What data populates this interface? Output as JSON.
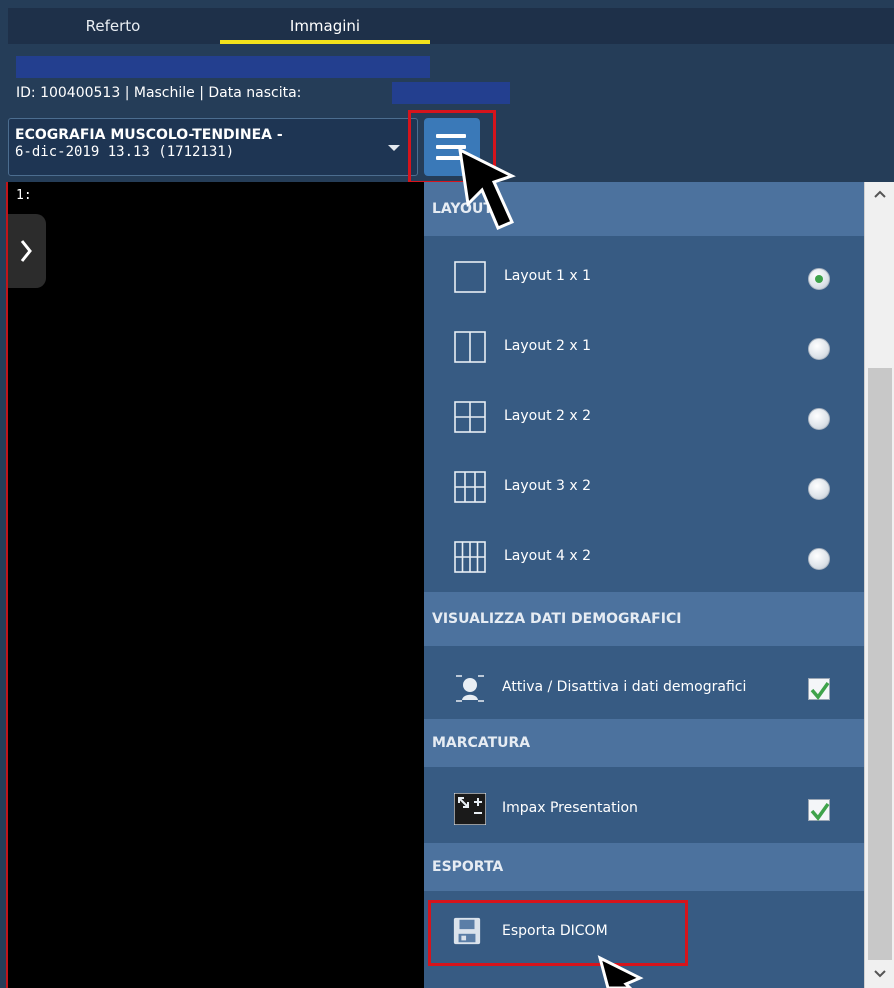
{
  "tabs": [
    {
      "label": "Referto",
      "active": false
    },
    {
      "label": "Immagini",
      "active": true
    }
  ],
  "patient": {
    "info_line": "ID: 100400513 | Maschile | Data nascita:"
  },
  "study_select": {
    "title": "ECOGRAFIA MUSCOLO-TENDINEA -",
    "date": "6-dic-2019 13.13 (1712131)"
  },
  "viewer": {
    "index_label": "1:"
  },
  "menu": {
    "layout_header": "LAYOUT",
    "layouts": [
      {
        "label": "Layout 1 x 1",
        "icon": "layout-1x1-icon",
        "selected": true
      },
      {
        "label": "Layout 2 x 1",
        "icon": "layout-2x1-icon",
        "selected": false
      },
      {
        "label": "Layout 2 x 2",
        "icon": "layout-2x2-icon",
        "selected": false
      },
      {
        "label": "Layout 3 x 2",
        "icon": "layout-3x2-icon",
        "selected": false
      },
      {
        "label": "Layout 4 x 2",
        "icon": "layout-4x2-icon",
        "selected": false
      }
    ],
    "demographics_header": "VISUALIZZA DATI DEMOGRAFICI",
    "demographics_toggle": {
      "label": "Attiva / Disattiva i dati demografici",
      "checked": true
    },
    "marking_header": "MARCATURA",
    "impax": {
      "label": "Impax Presentation",
      "checked": true
    },
    "export_header": "ESPORTA",
    "export_dicom": {
      "label": "Esporta DICOM"
    }
  },
  "colors": {
    "accent_tab": "#f2e21c",
    "highlight": "#d6141c",
    "menu_bg": "#375b83",
    "section_header": "#4c729e",
    "check_green": "#3fa34b"
  }
}
